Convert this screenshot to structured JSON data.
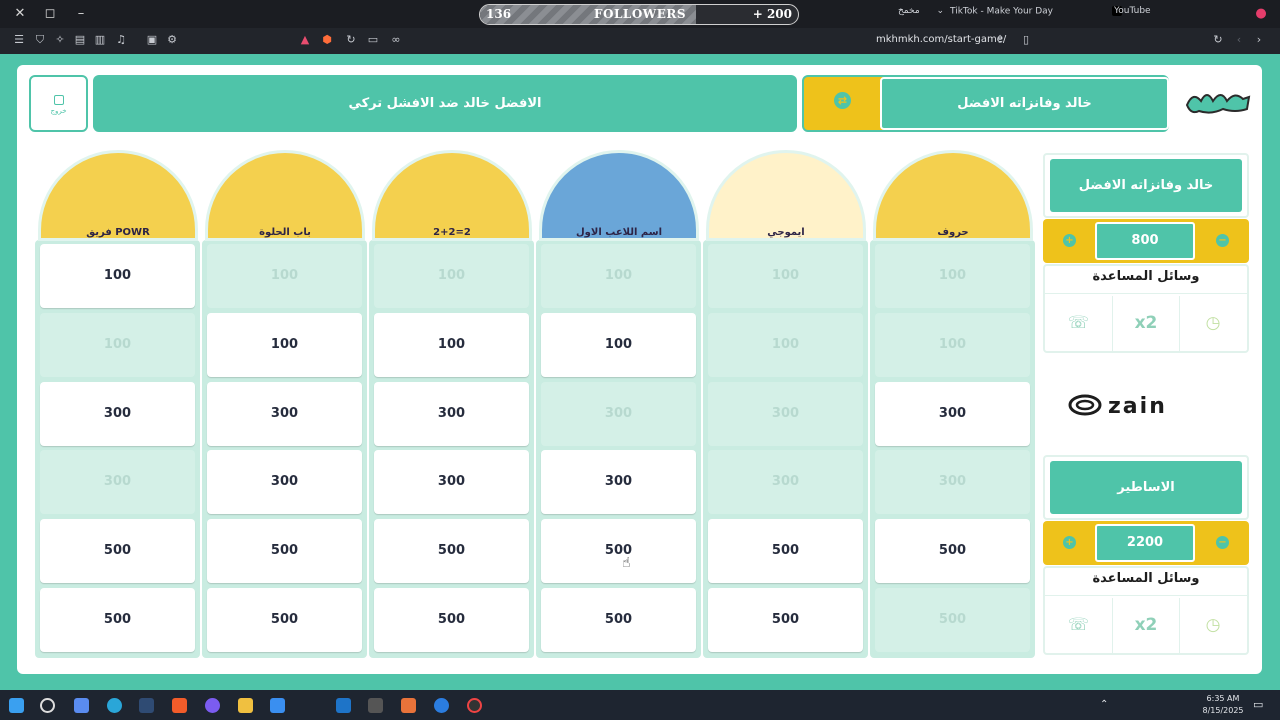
{
  "browser": {
    "followers": {
      "current": "136",
      "label": "FOLLOWERS",
      "goal": "+ 200",
      "progress": 0.68
    },
    "tabs": [
      {
        "title": "مخمخ"
      },
      {
        "title": "TikTok - Make Your Day"
      },
      {
        "title": "YouTube"
      }
    ],
    "url": "mkhmkh.com/start-game/"
  },
  "game": {
    "exit_label": "خروج",
    "matchup": "الافضل خالد ضد الافشل تركي",
    "current_turn": "خالد وفانزاته الافضل",
    "categories": [
      {
        "label": "فريق POWR",
        "color": "#f4d04e"
      },
      {
        "label": "باب الحلوة",
        "color": "#f4d04e"
      },
      {
        "label": "2+2=2",
        "color": "#f4d04e"
      },
      {
        "label": "اسم اللاعب الاول",
        "color": "#6aa6d8"
      },
      {
        "label": "ايموجي",
        "color": "#fff2c9"
      },
      {
        "label": "حروف",
        "color": "#f4d04e"
      }
    ],
    "board": [
      [
        {
          "v": "100",
          "on": true
        },
        {
          "v": "100",
          "on": false
        },
        {
          "v": "100",
          "on": false
        },
        {
          "v": "100",
          "on": false
        },
        {
          "v": "100",
          "on": false
        },
        {
          "v": "100",
          "on": false
        }
      ],
      [
        {
          "v": "100",
          "on": false
        },
        {
          "v": "100",
          "on": true
        },
        {
          "v": "100",
          "on": true
        },
        {
          "v": "100",
          "on": true
        },
        {
          "v": "100",
          "on": false
        },
        {
          "v": "100",
          "on": false
        }
      ],
      [
        {
          "v": "300",
          "on": true
        },
        {
          "v": "300",
          "on": true
        },
        {
          "v": "300",
          "on": true
        },
        {
          "v": "300",
          "on": false
        },
        {
          "v": "300",
          "on": false
        },
        {
          "v": "300",
          "on": true
        }
      ],
      [
        {
          "v": "300",
          "on": false
        },
        {
          "v": "300",
          "on": true
        },
        {
          "v": "300",
          "on": true
        },
        {
          "v": "300",
          "on": true
        },
        {
          "v": "300",
          "on": false
        },
        {
          "v": "300",
          "on": false
        }
      ],
      [
        {
          "v": "500",
          "on": true
        },
        {
          "v": "500",
          "on": true
        },
        {
          "v": "500",
          "on": true
        },
        {
          "v": "500",
          "on": true
        },
        {
          "v": "500",
          "on": true
        },
        {
          "v": "500",
          "on": true
        }
      ],
      [
        {
          "v": "500",
          "on": true
        },
        {
          "v": "500",
          "on": true
        },
        {
          "v": "500",
          "on": true
        },
        {
          "v": "500",
          "on": true
        },
        {
          "v": "500",
          "on": true
        },
        {
          "v": "500",
          "on": false
        }
      ]
    ],
    "teams": [
      {
        "name": "خالد وفانزاته الافضل",
        "score": "800",
        "helpers_title": "وسائل المساعدة",
        "helpers": [
          "phone-icon",
          "x2-icon",
          "clock-icon"
        ],
        "double_label": "x2"
      },
      {
        "name": "الاساطير",
        "score": "2200",
        "helpers_title": "وسائل المساعدة",
        "helpers": [
          "phone-icon",
          "x2-icon",
          "clock-icon"
        ],
        "double_label": "x2"
      }
    ],
    "sponsor": "zain",
    "colors": {
      "green": "#4fc4a9",
      "yellow": "#eec21b",
      "off": "#d4f0e7"
    }
  },
  "taskbar": {
    "time": "6:35 AM",
    "date": "8/15/2025"
  }
}
